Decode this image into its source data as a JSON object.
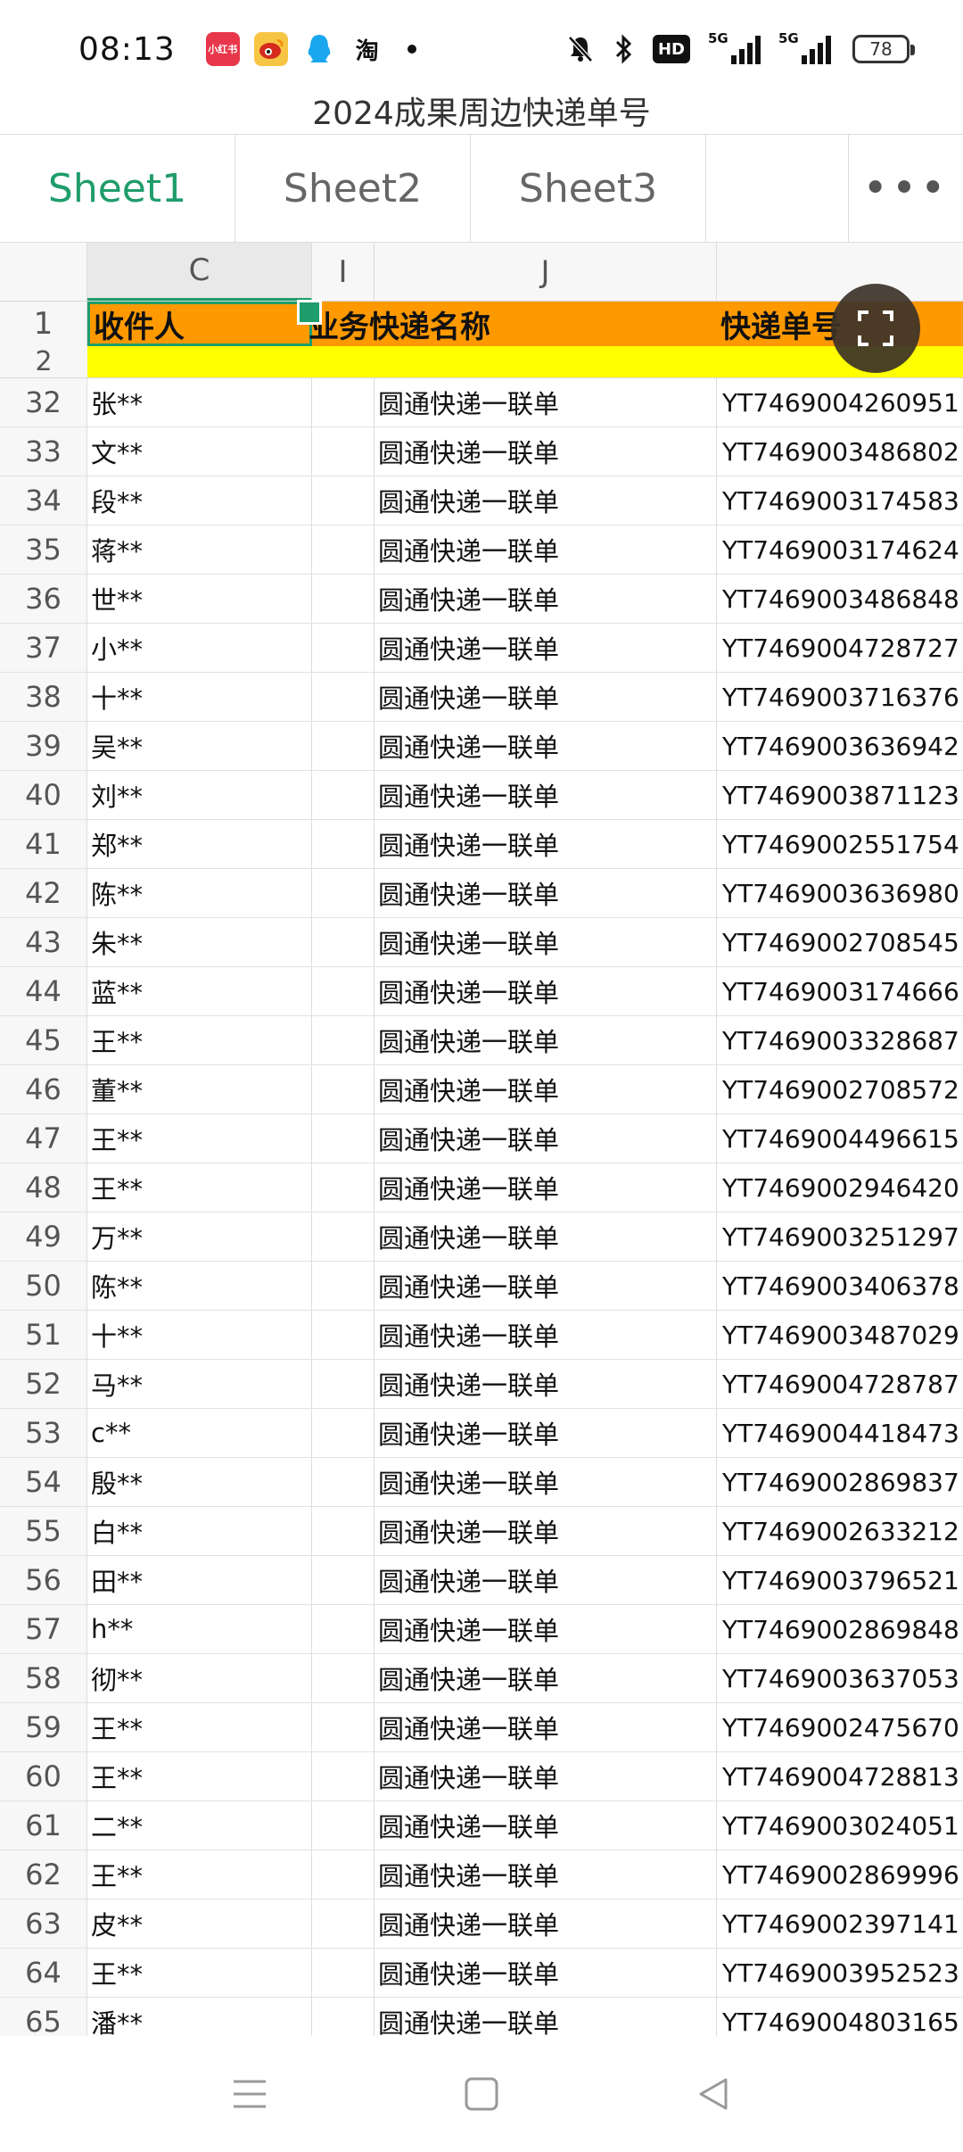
{
  "status_bar": {
    "time": "08:13",
    "apps": [
      "小红书",
      "微博",
      "QQ",
      "淘"
    ],
    "network_1": "5G",
    "network_2": "5G",
    "hd_label": "HD",
    "battery": "78"
  },
  "document": {
    "title": "2024成果周边快递单号"
  },
  "sheet_tabs": [
    {
      "label": "Sheet1",
      "active": true
    },
    {
      "label": "Sheet2",
      "active": false
    },
    {
      "label": "Sheet3",
      "active": false
    }
  ],
  "more_label": "•••",
  "columns": [
    "C",
    "I",
    "J",
    ""
  ],
  "header": {
    "row_number": "1",
    "recipient": "收件人",
    "service": "业务快递名称",
    "tracking": "快递单号"
  },
  "yellow_row_number": "2",
  "rows": [
    {
      "n": "32",
      "name": "张**",
      "service": "圆通快递一联单",
      "tracking": "YT7469004260951"
    },
    {
      "n": "33",
      "name": "文**",
      "service": "圆通快递一联单",
      "tracking": "YT7469003486802"
    },
    {
      "n": "34",
      "name": "段**",
      "service": "圆通快递一联单",
      "tracking": "YT7469003174583"
    },
    {
      "n": "35",
      "name": "蒋**",
      "service": "圆通快递一联单",
      "tracking": "YT7469003174624"
    },
    {
      "n": "36",
      "name": "世**",
      "service": "圆通快递一联单",
      "tracking": "YT7469003486848"
    },
    {
      "n": "37",
      "name": "小**",
      "service": "圆通快递一联单",
      "tracking": "YT7469004728727"
    },
    {
      "n": "38",
      "name": "十**",
      "service": "圆通快递一联单",
      "tracking": "YT7469003716376"
    },
    {
      "n": "39",
      "name": "吴**",
      "service": "圆通快递一联单",
      "tracking": "YT7469003636942"
    },
    {
      "n": "40",
      "name": "刘**",
      "service": "圆通快递一联单",
      "tracking": "YT7469003871123"
    },
    {
      "n": "41",
      "name": "郑**",
      "service": "圆通快递一联单",
      "tracking": "YT7469002551754"
    },
    {
      "n": "42",
      "name": "陈**",
      "service": "圆通快递一联单",
      "tracking": "YT7469003636980"
    },
    {
      "n": "43",
      "name": "朱**",
      "service": "圆通快递一联单",
      "tracking": "YT7469002708545"
    },
    {
      "n": "44",
      "name": "蓝**",
      "service": "圆通快递一联单",
      "tracking": "YT7469003174666"
    },
    {
      "n": "45",
      "name": "王**",
      "service": "圆通快递一联单",
      "tracking": "YT7469003328687"
    },
    {
      "n": "46",
      "name": "董**",
      "service": "圆通快递一联单",
      "tracking": "YT7469002708572"
    },
    {
      "n": "47",
      "name": "王**",
      "service": "圆通快递一联单",
      "tracking": "YT7469004496615"
    },
    {
      "n": "48",
      "name": "王**",
      "service": "圆通快递一联单",
      "tracking": "YT7469002946420"
    },
    {
      "n": "49",
      "name": "万**",
      "service": "圆通快递一联单",
      "tracking": "YT7469003251297"
    },
    {
      "n": "50",
      "name": "陈**",
      "service": "圆通快递一联单",
      "tracking": "YT7469003406378"
    },
    {
      "n": "51",
      "name": "十**",
      "service": "圆通快递一联单",
      "tracking": "YT7469003487029"
    },
    {
      "n": "52",
      "name": "马**",
      "service": "圆通快递一联单",
      "tracking": "YT7469004728787"
    },
    {
      "n": "53",
      "name": "c**",
      "service": "圆通快递一联单",
      "tracking": "YT7469004418473"
    },
    {
      "n": "54",
      "name": "殷**",
      "service": "圆通快递一联单",
      "tracking": "YT7469002869837"
    },
    {
      "n": "55",
      "name": "白**",
      "service": "圆通快递一联单",
      "tracking": "YT7469002633212"
    },
    {
      "n": "56",
      "name": "田**",
      "service": "圆通快递一联单",
      "tracking": "YT7469003796521"
    },
    {
      "n": "57",
      "name": "h**",
      "service": "圆通快递一联单",
      "tracking": "YT7469002869848"
    },
    {
      "n": "58",
      "name": "彻**",
      "service": "圆通快递一联单",
      "tracking": "YT7469003637053"
    },
    {
      "n": "59",
      "name": "王**",
      "service": "圆通快递一联单",
      "tracking": "YT7469002475670"
    },
    {
      "n": "60",
      "name": "王**",
      "service": "圆通快递一联单",
      "tracking": "YT7469004728813"
    },
    {
      "n": "61",
      "name": "二**",
      "service": "圆通快递一联单",
      "tracking": "YT7469003024051"
    },
    {
      "n": "62",
      "name": "王**",
      "service": "圆通快递一联单",
      "tracking": "YT7469002869996"
    },
    {
      "n": "63",
      "name": "皮**",
      "service": "圆通快递一联单",
      "tracking": "YT7469002397141"
    },
    {
      "n": "64",
      "name": "王**",
      "service": "圆通快递一联单",
      "tracking": "YT7469003952523"
    },
    {
      "n": "65",
      "name": "潘**",
      "service": "圆通快递一联单",
      "tracking": "YT7469004803165"
    }
  ],
  "colors": {
    "accent": "#1f9d6b",
    "header_fill": "#ff9900",
    "row2_fill": "#ffff00"
  }
}
